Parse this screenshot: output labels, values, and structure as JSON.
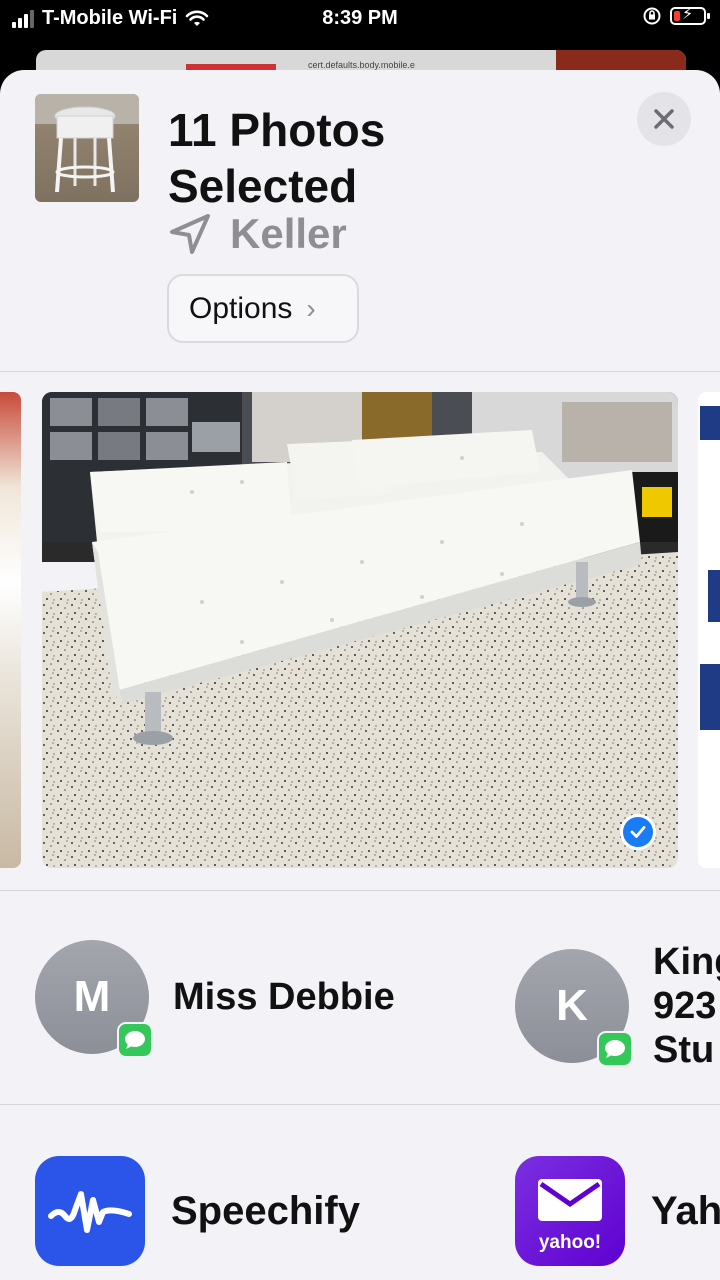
{
  "status_bar": {
    "carrier": "T-Mobile Wi-Fi",
    "time": "8:39 PM",
    "battery_color": "#ff3b30"
  },
  "background_page": {
    "snippet": "cert.defaults.body.mobile.e"
  },
  "share_sheet": {
    "title_line1": "11 Photos",
    "title_line2": "Selected",
    "location": "Keller",
    "options_label": "Options",
    "close_icon": "close-icon",
    "selected_photo": {
      "description_icon": "checkmark-icon",
      "selected": true
    },
    "people": [
      {
        "initial": "M",
        "name": "Miss Debbie",
        "badge": "messages-icon"
      },
      {
        "initial": "K",
        "name_lines": [
          "King",
          "923",
          "Stu"
        ],
        "badge": "messages-icon"
      }
    ],
    "apps": [
      {
        "name": "Speechify",
        "icon": "speechify-icon",
        "color": "#2b54e8"
      },
      {
        "name": "Yah",
        "icon": "yahoo-mail-icon",
        "icon_text": "yahoo!",
        "color": "#6001d2"
      }
    ]
  }
}
